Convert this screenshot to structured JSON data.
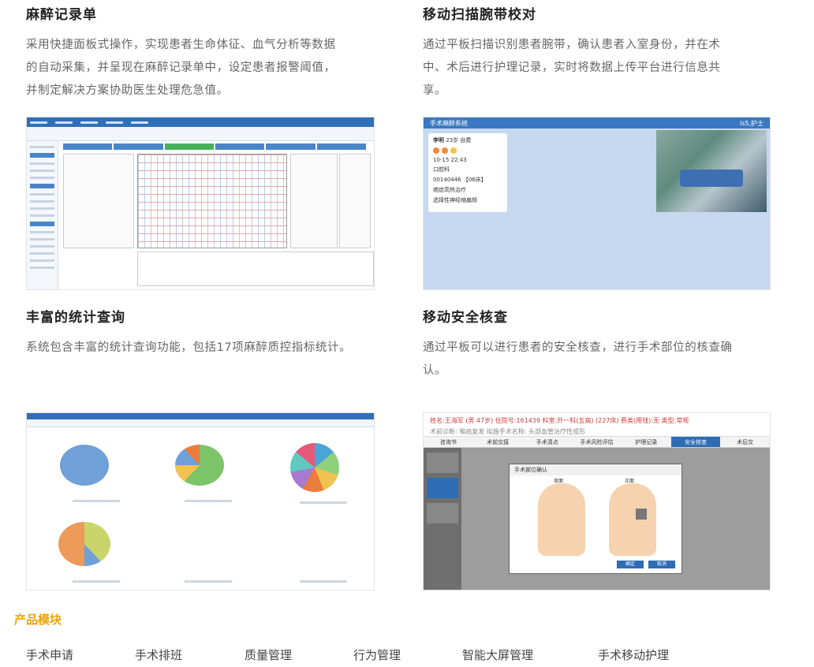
{
  "features": [
    {
      "title": "麻醉记录单",
      "lines": [
        "采用快捷面板式操作，实现患者生命体征、血气分析等数据",
        "的自动采集，并呈现在麻醉记录单中，设定患者报警阈值，",
        "并制定解决方案协助医生处理危急值。"
      ]
    },
    {
      "title": "移动扫描腕带校对",
      "lines": [
        "通过平板扫描识别患者腕带，确认患者入室身份，并在术",
        "中、术后进行护理记录，实时将数据上传平台进行信息共",
        "享。"
      ]
    },
    {
      "title": "丰富的统计查询",
      "lines": [
        "系统包含丰富的统计查询功能，包括17项麻醉质控指标统计。"
      ]
    },
    {
      "title": "移动安全核查",
      "lines": [
        "通过平板可以进行患者的安全核查，进行手术部位的核查确",
        "认。"
      ]
    }
  ],
  "screens": {
    "mobile_scan": {
      "app_title": "手术麻醉系统",
      "user": "ls5,护士",
      "patient_name": "李明",
      "patient_meta": "23岁 自费",
      "time": "10-15 22:43",
      "dept": "口腔科",
      "bed": "00140446 【06床】",
      "diagnosis": "癌症高热治疗",
      "procedure": "选择性神经缩扁频"
    },
    "safety": {
      "header": "姓名:王海军 (男 47岁) 住院号:161439 科室:外一科(五病) (227床) 费类(用钱):无 类型:常规",
      "sub": "术前诊断: 喉癌复发  拟施手术名称: 头部血管治疗性成形",
      "tabs": [
        "咨询书",
        "术前交接",
        "手术清点",
        "手术风险评估",
        "护理记录",
        "安全核查",
        "术后交"
      ],
      "active_tab": "安全核查",
      "modal_title": "手术部位确认",
      "back_label": "背面",
      "front_label": "正面",
      "confirm": "确定",
      "cancel": "取消"
    }
  },
  "module_section": {
    "title": "产品模块",
    "items": [
      "手术申请",
      "手术排班",
      "质量管理",
      "行为管理",
      "智能大屏管理",
      "手术移动护理"
    ]
  },
  "colors": {
    "accent": "#f0a30a",
    "primary_blue": "#2f6fb8"
  }
}
